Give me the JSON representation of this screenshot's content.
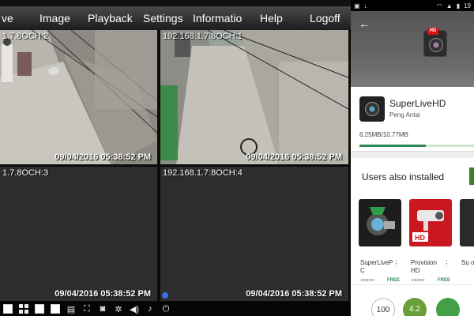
{
  "dvr": {
    "menu": [
      {
        "label": "ve"
      },
      {
        "label": "Image"
      },
      {
        "label": "Playback"
      },
      {
        "label": "Settings"
      },
      {
        "label": "Informatio"
      },
      {
        "label": "Help"
      },
      {
        "label": "Logoff"
      }
    ],
    "cameras": [
      {
        "label": "1.7.8OCH:2",
        "timestamp": "09/04/2016 05:38:52 PM"
      },
      {
        "label": "192.168.1.7:8OCH:1",
        "timestamp": "09/04/2016 05:38:52 PM"
      },
      {
        "label": "1.7.8OCH:3",
        "timestamp": "09/04/2016 05:38:52 PM"
      },
      {
        "label": "192.168.1.7:8OCH:4",
        "timestamp": "09/04/2016 05:38:52 PM"
      }
    ]
  },
  "phone": {
    "status": {
      "time": "19"
    },
    "app": {
      "name": "SuperLiveHD",
      "developer": "Peng Antai",
      "download": "6.25MB/10.77MB",
      "progress": 0.58
    },
    "also": {
      "title": "Users also installed",
      "items": [
        {
          "name": "SuperLiveP C",
          "price": "FREE"
        },
        {
          "name": "Provision HD",
          "price": "FREE"
        },
        {
          "name": "Su o",
          "price": ""
        }
      ]
    },
    "badges": [
      {
        "value": "100"
      },
      {
        "value": "4.2"
      },
      {
        "value": ""
      }
    ]
  }
}
